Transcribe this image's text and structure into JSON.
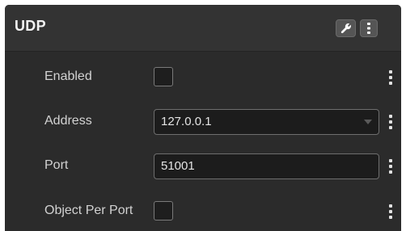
{
  "panel": {
    "title": "UDP",
    "header_icons": [
      "wrench-icon",
      "more-vertical-icon"
    ]
  },
  "fields": {
    "enabled": {
      "label": "Enabled",
      "checked": false
    },
    "address": {
      "label": "Address",
      "value": "127.0.0.1"
    },
    "port": {
      "label": "Port",
      "value": "51001"
    },
    "object_per_port": {
      "label": "Object Per Port",
      "checked": false
    }
  },
  "colors": {
    "panel_bg": "#2b2b2b",
    "header_bg": "#333333",
    "text": "#d2d2d2",
    "field_bg": "#1c1c1c",
    "field_border": "#6e6e6e"
  }
}
